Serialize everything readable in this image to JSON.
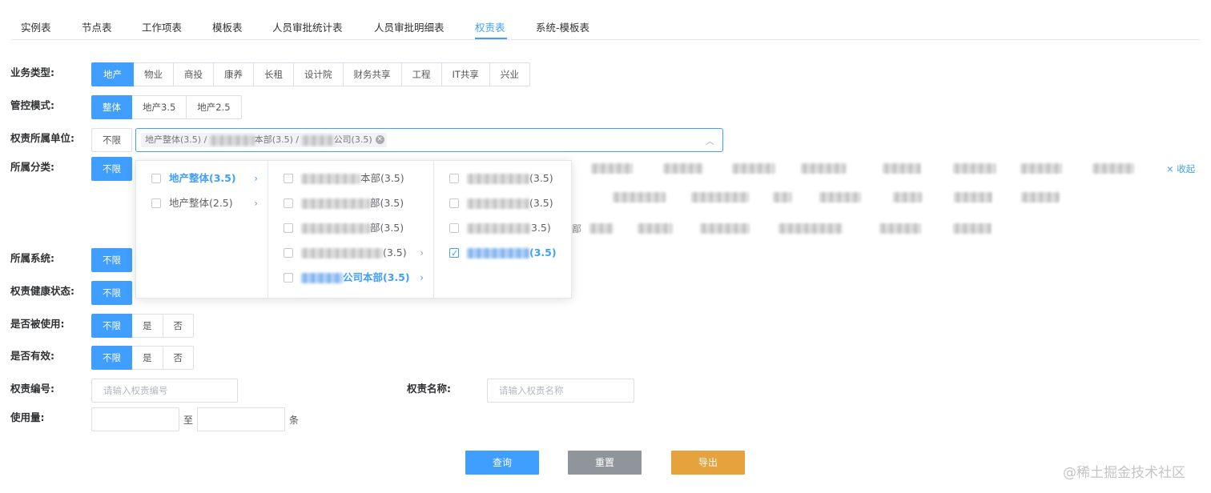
{
  "tabs": [
    "实例表",
    "节点表",
    "工作项表",
    "模板表",
    "人员审批统计表",
    "人员审批明细表",
    "权责表",
    "系统-模板表"
  ],
  "active_tab": "权责表",
  "labels": {
    "business_type": "业务类型:",
    "control_mode": "管控模式:",
    "owning_unit": "权责所属单位:",
    "category": "所属分类:",
    "system": "所属系统:",
    "health": "权责健康状态:",
    "used": "是否被使用:",
    "valid": "是否有效:",
    "code": "权责编号:",
    "name": "权责名称:",
    "usage": "使用量:"
  },
  "business_types": [
    "地产",
    "物业",
    "商投",
    "康养",
    "长租",
    "设计院",
    "财务共享",
    "工程",
    "IT共享",
    "兴业"
  ],
  "business_type_selected": "地产",
  "control_modes": [
    "整体",
    "地产3.5",
    "地产2.5"
  ],
  "control_mode_selected": "整体",
  "unlimited": "不限",
  "yes": "是",
  "no": "否",
  "unit_tag": {
    "prefix": "地产整体(3.5) / ",
    "mid": "本部(3.5) / ",
    "suffix": "公司(3.5)"
  },
  "collapse_label": "× 收起",
  "category_fragment": "鄙",
  "cascader": {
    "col1": [
      {
        "label": "地产整体(3.5)",
        "active": true
      },
      {
        "label": "地产整体(2.5)",
        "active": false
      }
    ],
    "col2": [
      {
        "suffix": "本部(3.5)",
        "has_children": false,
        "checked": false
      },
      {
        "suffix": "部(3.5)",
        "has_children": false,
        "checked": false
      },
      {
        "suffix": "部(3.5)",
        "has_children": false,
        "checked": false
      },
      {
        "suffix": "(3.5)",
        "has_children": true,
        "checked": false
      },
      {
        "suffix": "公司本部(3.5)",
        "has_children": true,
        "checked": false,
        "active": true
      }
    ],
    "col3": [
      {
        "suffix": "(3.5)",
        "checked": false
      },
      {
        "suffix": "(3.5)",
        "checked": false
      },
      {
        "suffix": "3.5)",
        "checked": false
      },
      {
        "suffix": "(3.5)",
        "checked": true
      }
    ]
  },
  "code_placeholder": "请输入权责编号",
  "name_placeholder": "请输入权责名称",
  "usage_to": "至",
  "usage_unit": "条",
  "buttons": {
    "query": "查询",
    "reset": "重置",
    "export": "导出"
  },
  "colors": {
    "primary": "#409eff",
    "query": "#409eff",
    "reset": "#8f959a",
    "export": "#e6a23c"
  },
  "watermark": "@稀土掘金技术社区"
}
